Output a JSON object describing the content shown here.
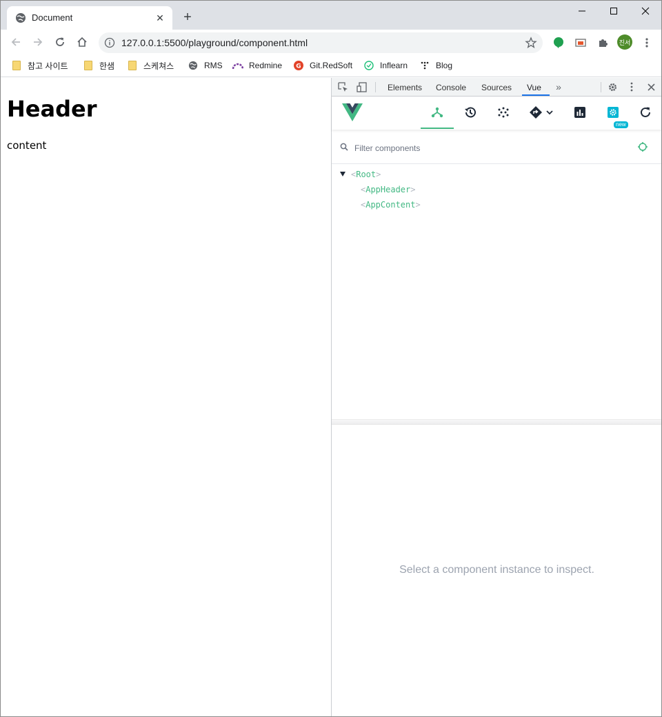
{
  "browser": {
    "tab": {
      "title": "Document",
      "favicon": "globe-icon",
      "close": "✕"
    },
    "new_tab": "+",
    "window_controls": [
      "minimize-icon",
      "maximize-icon",
      "close-icon"
    ],
    "url": "127.0.0.1:5500/playground/component.html",
    "avatar_text": "진서",
    "bookmarks": [
      {
        "label": "참고 사이트",
        "icon": "folder-icon"
      },
      {
        "label": "한샘",
        "icon": "folder-icon"
      },
      {
        "label": "스케쳐스",
        "icon": "folder-icon"
      },
      {
        "label": "RMS",
        "icon": "globe-icon"
      },
      {
        "label": "Redmine",
        "icon": "redmine-icon"
      },
      {
        "label": "Git.RedSoft",
        "icon": "gitlab-icon"
      },
      {
        "label": "Inflearn",
        "icon": "inflearn-icon"
      },
      {
        "label": "Blog",
        "icon": "blog-icon"
      }
    ]
  },
  "page": {
    "heading": "Header",
    "content": "content"
  },
  "devtools": {
    "tabs": [
      "Elements",
      "Console",
      "Sources",
      "Vue"
    ],
    "active_tab": "Vue",
    "vue": {
      "filter_placeholder": "Filter components",
      "new_badge": "new",
      "tree": {
        "root": "Root",
        "children": [
          "AppHeader",
          "AppContent"
        ]
      },
      "inspect_message": "Select a component instance to inspect."
    }
  },
  "colors": {
    "vue_green": "#42b883",
    "devtools_tab_underline": "#1a73e8"
  }
}
